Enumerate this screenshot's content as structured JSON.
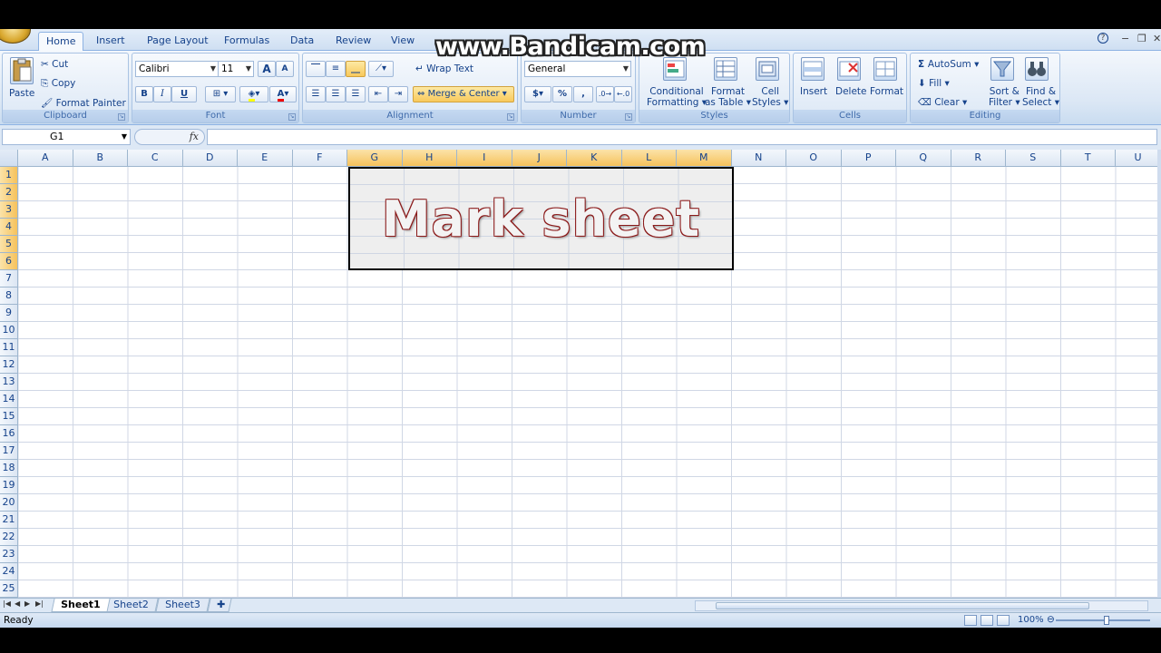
{
  "watermark": "www.Bandicam.com",
  "tabs": [
    {
      "label": "Home"
    },
    {
      "label": "Insert"
    },
    {
      "label": "Page Layout"
    },
    {
      "label": "Formulas"
    },
    {
      "label": "Data"
    },
    {
      "label": "Review"
    },
    {
      "label": "View"
    }
  ],
  "window_controls": {
    "help": "?",
    "minimize": "−",
    "restore": "❐",
    "close": "✕"
  },
  "clipboard": {
    "paste": "Paste",
    "cut": "Cut",
    "copy": "Copy",
    "format_painter": "Format Painter",
    "label": "Clipboard"
  },
  "font": {
    "family": "Calibri",
    "size": "11",
    "bold": "B",
    "italic": "I",
    "underline": "U",
    "grow": "A",
    "shrink": "A",
    "label": "Font"
  },
  "alignment": {
    "wrap_text": "Wrap Text",
    "merge_center": "Merge & Center",
    "label": "Alignment"
  },
  "number": {
    "format": "General",
    "currency": "$",
    "percent": "%",
    "comma": ",",
    "label": "Number"
  },
  "styles": {
    "conditional_line1": "Conditional",
    "conditional_line2": "Formatting",
    "format_table_line1": "Format",
    "format_table_line2": "as Table",
    "cell_styles_line1": "Cell",
    "cell_styles_line2": "Styles",
    "label": "Styles"
  },
  "cells_group": {
    "insert": "Insert",
    "delete": "Delete",
    "format": "Format",
    "label": "Cells"
  },
  "editing": {
    "autosum": "AutoSum",
    "fill": "Fill",
    "clear": "Clear",
    "sort_line1": "Sort &",
    "sort_line2": "Filter",
    "find_line1": "Find &",
    "find_line2": "Select",
    "label": "Editing"
  },
  "formula_bar": {
    "name_box": "G1",
    "fx": "fx",
    "value": ""
  },
  "columns": [
    "A",
    "B",
    "C",
    "D",
    "E",
    "F",
    "G",
    "H",
    "I",
    "J",
    "K",
    "L",
    "M",
    "N",
    "O",
    "P",
    "Q",
    "R",
    "S",
    "T",
    "U"
  ],
  "selected_columns": [
    "G",
    "H",
    "I",
    "J",
    "K",
    "L",
    "M"
  ],
  "rows": [
    "1",
    "2",
    "3",
    "4",
    "5",
    "6",
    "7",
    "8",
    "9",
    "10",
    "11",
    "12",
    "13",
    "14",
    "15",
    "16",
    "17",
    "18",
    "19",
    "20",
    "21",
    "22",
    "23",
    "24",
    "25"
  ],
  "selected_rows": [
    "1",
    "2",
    "3",
    "4",
    "5",
    "6"
  ],
  "merged_cell_text": "Mark sheet",
  "sheets": [
    {
      "label": "Sheet1"
    },
    {
      "label": "Sheet2"
    },
    {
      "label": "Sheet3"
    }
  ],
  "status": {
    "text": "Ready",
    "zoom": "100%"
  }
}
